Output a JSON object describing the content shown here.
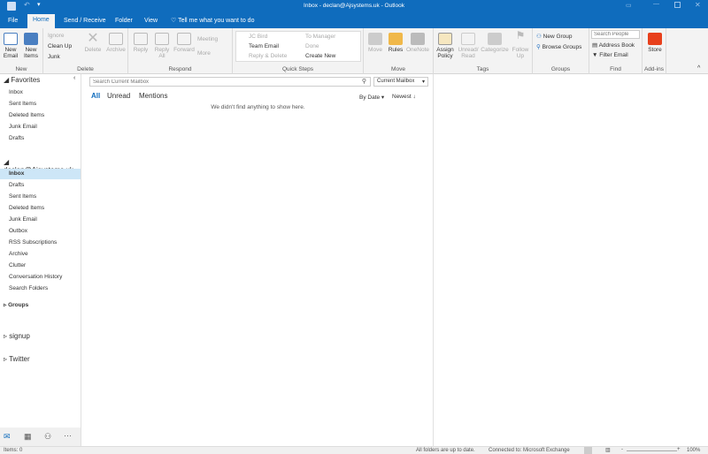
{
  "window": {
    "title": "Inbox - declan@Ajsystems.uk - Outlook"
  },
  "tabs": [
    "File",
    "Home",
    "Send / Receive",
    "Folder",
    "View"
  ],
  "tell_me": "Tell me what you want to do",
  "ribbon": {
    "new": {
      "label": "New",
      "new_email": "New Email",
      "new_items": "New Items"
    },
    "delete": {
      "label": "Delete",
      "ignore": "Ignore",
      "clean_up": "Clean Up",
      "junk": "Junk",
      "delete": "Delete",
      "archive": "Archive"
    },
    "respond": {
      "label": "Respond",
      "reply": "Reply",
      "reply_all": "Reply All",
      "forward": "Forward",
      "meeting": "Meeting",
      "more": "More"
    },
    "quick_steps": {
      "label": "Quick Steps",
      "items": [
        "JC Bird",
        "To Manager",
        "Team Email",
        "Done",
        "Reply & Delete",
        "Create New"
      ]
    },
    "move": {
      "label": "Move",
      "move": "Move",
      "rules": "Rules",
      "onenote": "OneNote"
    },
    "tags": {
      "label": "Tags",
      "assign_policy": "Assign Policy",
      "unread_read": "Unread/ Read",
      "categorize": "Categorize",
      "follow_up": "Follow Up"
    },
    "groups": {
      "label": "Groups",
      "new_group": "New Group",
      "browse_groups": "Browse Groups"
    },
    "find": {
      "label": "Find",
      "search_people_placeholder": "Search People",
      "address_book": "Address Book",
      "filter_email": "Filter Email"
    },
    "addins": {
      "label": "Add-ins",
      "store": "Store"
    }
  },
  "folders": {
    "favorites_header": "Favorites",
    "favorites": [
      "Inbox",
      "Sent Items",
      "Deleted Items",
      "Junk Email",
      "Drafts"
    ],
    "account": "declan@Ajsystems.uk",
    "account_folders": [
      "Inbox",
      "Drafts",
      "Sent Items",
      "Deleted Items",
      "Junk Email",
      "Outbox",
      "RSS Subscriptions",
      "Archive",
      "Clutter",
      "Conversation History",
      "Search Folders"
    ],
    "groups": "Groups",
    "other": [
      "signup",
      "Twitter"
    ]
  },
  "list": {
    "search_placeholder": "Search Current Mailbox",
    "scope": "Current Mailbox",
    "filters": [
      "All",
      "Unread",
      "Mentions"
    ],
    "sort": "By Date",
    "order": "Newest",
    "empty": "We didn't find anything to show here."
  },
  "status": {
    "items": "Items: 0",
    "sync": "All folders are up to date.",
    "connection": "Connected to: Microsoft Exchange",
    "zoom": "100%"
  }
}
